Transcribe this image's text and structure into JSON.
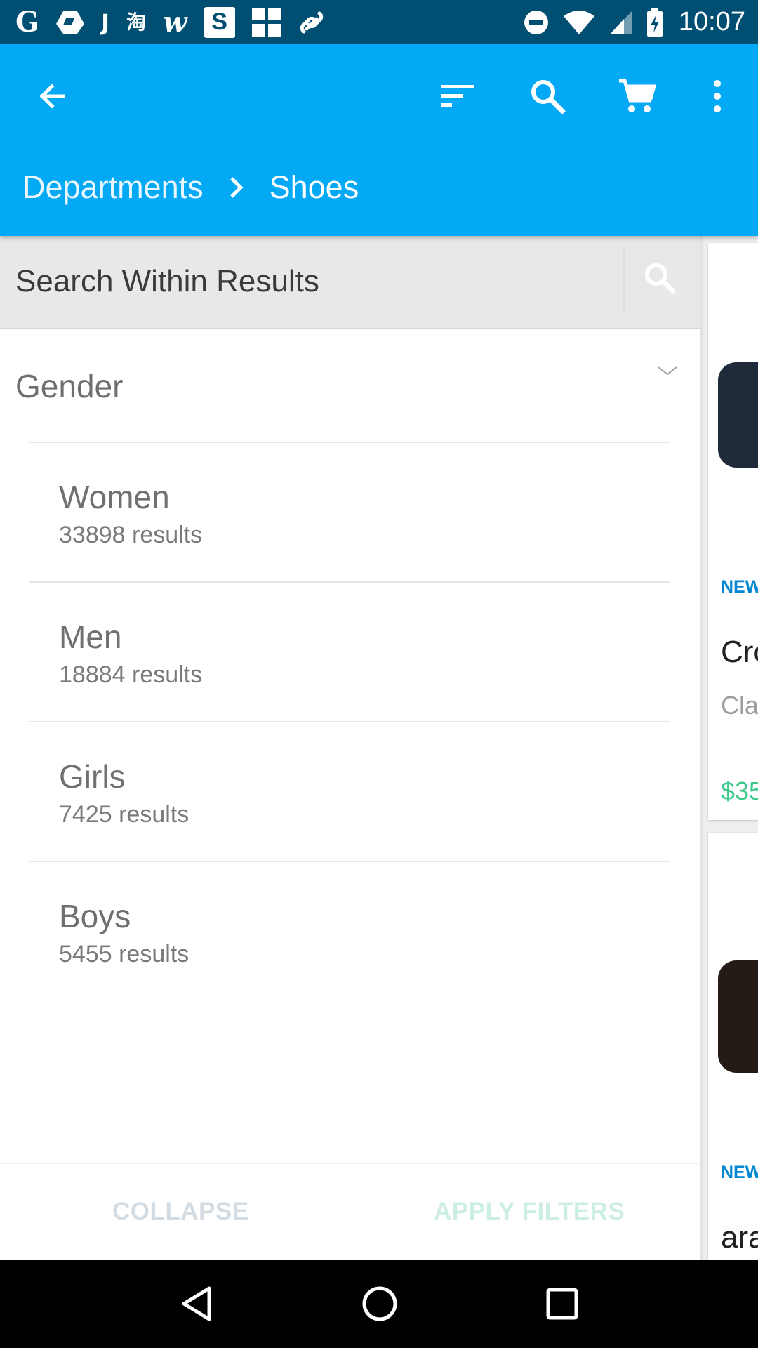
{
  "status_bar": {
    "app_icons": [
      "G",
      "◆",
      "J",
      "淘",
      "w",
      "S",
      "⊞",
      "℘"
    ],
    "time": "10:07"
  },
  "app_bar": {
    "icons": [
      "back-arrow-icon",
      "sort-icon",
      "search-icon",
      "cart-icon",
      "more-vert-icon"
    ],
    "breadcrumb": {
      "parent": "Departments",
      "current": "Shoes"
    },
    "color": "#03a9f4"
  },
  "filter_panel": {
    "search_placeholder": "Search Within Results",
    "section_title": "Gender",
    "options": [
      {
        "name": "Women",
        "count": "33898 results"
      },
      {
        "name": "Men",
        "count": "18884 results"
      },
      {
        "name": "Girls",
        "count": "7425 results"
      },
      {
        "name": "Boys",
        "count": "5455 results"
      }
    ],
    "collapse_label": "COLLAPSE",
    "apply_label": "APPLY FILTERS"
  },
  "product_peek": {
    "card1": {
      "badge": "NEW",
      "title": "Cro",
      "subtitle": "Cla",
      "price": "$35"
    },
    "card2": {
      "badge": "NEW",
      "title": "ara"
    }
  },
  "nav_bar": {
    "icons": [
      "back-triangle-icon",
      "home-circle-icon",
      "recents-square-icon"
    ]
  }
}
